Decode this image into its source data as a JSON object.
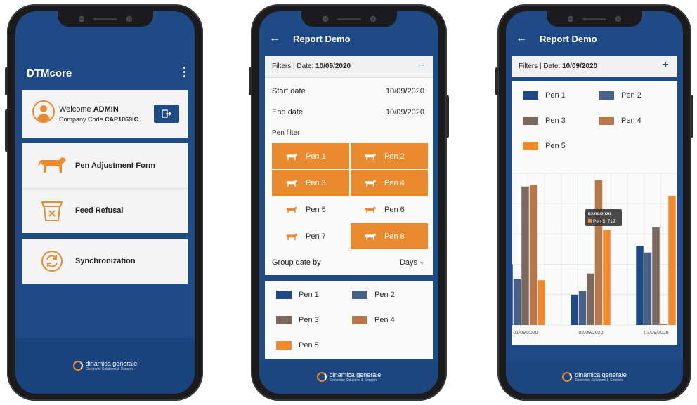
{
  "phone1": {
    "app_title": "DTMcore",
    "welcome_prefix": "Welcome",
    "user": "ADMIN",
    "company_prefix": "Company Code",
    "company_code": "CAP1069IC",
    "menu": [
      {
        "label": "Pen Adjustment Form",
        "icon": "cow-icon"
      },
      {
        "label": "Feed Refusal",
        "icon": "bin-x-icon"
      },
      {
        "label": "Synchronization",
        "icon": "sync-icon"
      }
    ]
  },
  "phone2": {
    "title": "Report Demo",
    "filters_prefix": "Filters | Date:",
    "filters_date": "10/09/2020",
    "collapse_symbol": "−",
    "start_label": "Start date",
    "start_value": "10/09/2020",
    "end_label": "End date",
    "end_value": "10/09/2020",
    "pen_filter_label": "Pen filter",
    "pens": [
      {
        "label": "Pen 1",
        "selected": true
      },
      {
        "label": "Pen 2",
        "selected": true
      },
      {
        "label": "Pen 3",
        "selected": true
      },
      {
        "label": "Pen 4",
        "selected": true
      },
      {
        "label": "Pen 5",
        "selected": false
      },
      {
        "label": "Pen 6",
        "selected": false
      },
      {
        "label": "Pen 7",
        "selected": false
      },
      {
        "label": "Pen 8",
        "selected": true
      }
    ],
    "group_label": "Group date by",
    "group_value": "Days",
    "legend": [
      "Pen 1",
      "Pen 2",
      "Pen 3",
      "Pen 4",
      "Pen 5"
    ]
  },
  "phone3": {
    "title": "Report Demo",
    "filters_prefix": "Filters | Date:",
    "filters_date": "10/09/2020",
    "expand_symbol": "+",
    "legend": [
      "Pen 1",
      "Pen 2",
      "Pen 3",
      "Pen 4",
      "Pen 5"
    ],
    "tooltip_date": "02/09/2020",
    "tooltip_value": "Pen 5: 719"
  },
  "brand": {
    "name": "dinamica generale",
    "tagline": "Electronic Solutions & Sensors"
  },
  "colors": {
    "primary": "#1f4a86",
    "accent": "#e98a30",
    "pen1": "#1f4a86",
    "pen2": "#4b6288",
    "pen3": "#7b685e",
    "pen4": "#b8774a",
    "pen5": "#ef8a2e"
  },
  "chart_data": {
    "type": "bar",
    "categories": [
      "01/09/2020",
      "02/09/2020",
      "03/09/2020"
    ],
    "series": [
      {
        "name": "Pen 1",
        "values": [
          460,
          230,
          600
        ]
      },
      {
        "name": "Pen 2",
        "values": [
          350,
          260,
          550
        ]
      },
      {
        "name": "Pen 3",
        "values": [
          1050,
          390,
          740
        ]
      },
      {
        "name": "Pen 4",
        "values": [
          1060,
          1100,
          10
        ]
      },
      {
        "name": "Pen 5",
        "values": [
          340,
          719,
          980
        ]
      }
    ],
    "ylim": [
      0,
      1150
    ],
    "grid": true,
    "legend": "top"
  }
}
